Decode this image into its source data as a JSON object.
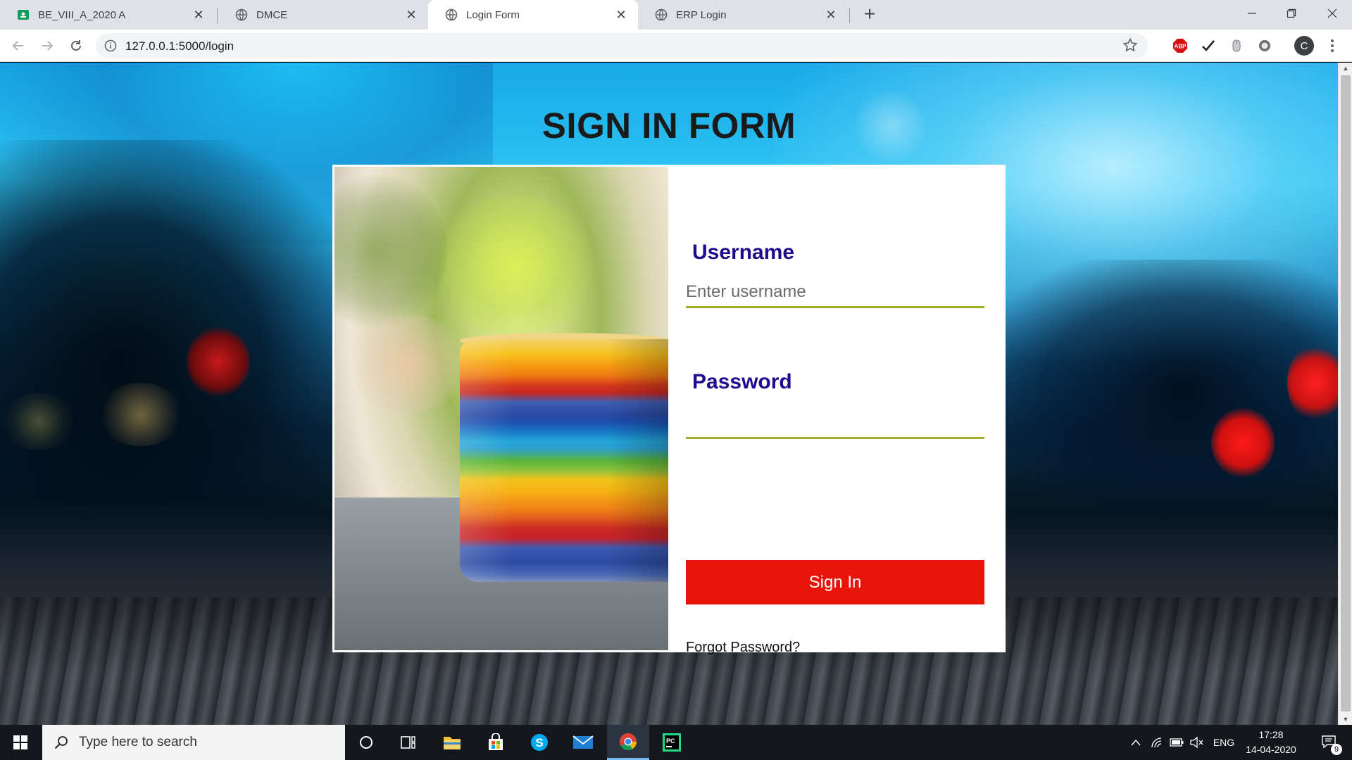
{
  "browser": {
    "tabs": [
      {
        "label": "BE_VIII_A_2020 A",
        "favicon": "classroom-icon",
        "active": false
      },
      {
        "label": "DMCE",
        "favicon": "globe-icon",
        "active": false
      },
      {
        "label": "Login Form",
        "favicon": "globe-icon",
        "active": true
      },
      {
        "label": "ERP Login",
        "favicon": "globe-icon",
        "active": false
      }
    ],
    "url": "127.0.0.1:5000/login",
    "profile_initial": "C",
    "extensions": [
      "adblock-icon",
      "checkmark-icon",
      "mouse-icon",
      "circle-icon"
    ]
  },
  "page": {
    "title": "SIGN IN FORM",
    "username_label": "Username",
    "username_placeholder": "Enter username",
    "password_label": "Password",
    "signin_label": "Sign In",
    "forgot_label": "Forgot Password?",
    "colors": {
      "label": "#1f0b8f",
      "button": "#e8140a",
      "underline": "#a4ad2a"
    }
  },
  "taskbar": {
    "search_placeholder": "Type here to search",
    "language": "ENG",
    "time": "17:28",
    "date": "14-04-2020",
    "notification_count": "9"
  }
}
